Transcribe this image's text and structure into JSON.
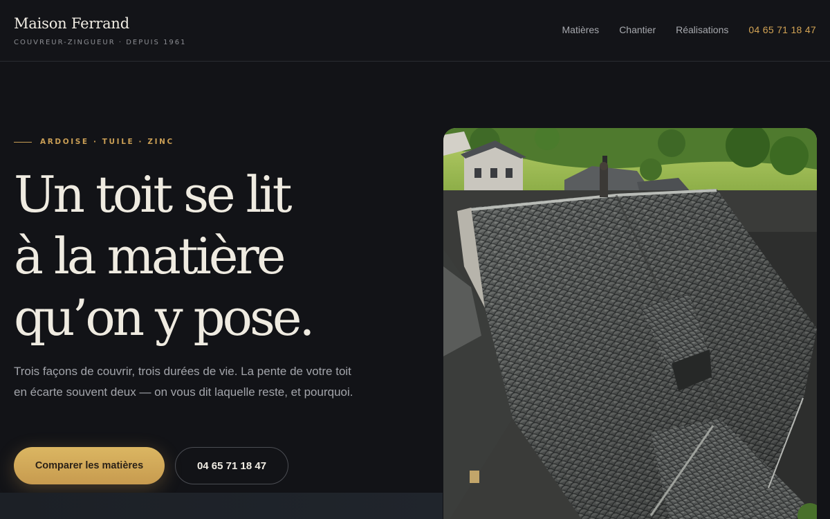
{
  "brand": {
    "name": "Maison Ferrand",
    "tagline": "COUVREUR-ZINGUEUR · DEPUIS 1961"
  },
  "nav": {
    "items": [
      {
        "label": "Matières"
      },
      {
        "label": "Chantier"
      },
      {
        "label": "Réalisations"
      }
    ],
    "phone": "04 65 71 18 47"
  },
  "hero": {
    "eyebrow": "ARDOISE · TUILE · ZINC",
    "headline": {
      "line1": "Un toit se lit",
      "line2": "à la matière",
      "line3": "qu’on y pose."
    },
    "lead": "Trois façons de couvrir, trois durées de vie. La pente de votre toit en écarte souvent deux — on vous dit laquelle reste, et pourquoi.",
    "primary_cta": "Comparer les matières",
    "secondary_cta": "04 65 71 18 47"
  },
  "colors": {
    "background": "#121317",
    "accent_gold": "#d3a455",
    "text_light": "#efebe1",
    "text_muted": "#a3a5ab"
  }
}
